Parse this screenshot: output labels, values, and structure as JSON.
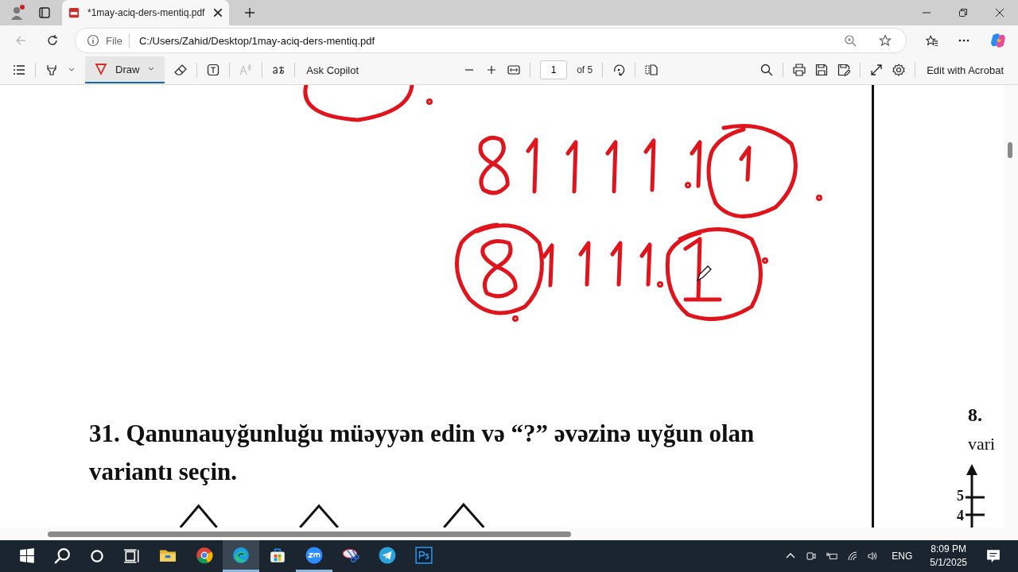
{
  "browser": {
    "tabs": [
      {
        "title": "*1may-aciq-ders-mentiq.pdf",
        "selected": true
      }
    ],
    "address": {
      "scheme_label": "File",
      "url": "C:/Users/Zahid/Desktop/1may-aciq-ders-mentiq.pdf"
    }
  },
  "pdf_toolbar": {
    "draw_label": "Draw",
    "draw_selected": true,
    "ask_label": "Ask Copilot",
    "page": "1",
    "page_count": "of 5",
    "acrobat_label": "Edit with Acrobat"
  },
  "document": {
    "question": {
      "number": "31.",
      "text": "Qanunauyğunluğu müəyyən edin və “?” əvəzinə uyğun olan variantı seçin."
    },
    "next_page": {
      "number_text": "8.",
      "line_2": "vari",
      "axis_ticks": [
        "5",
        "4"
      ]
    }
  },
  "taskbar": {
    "apps": [
      {
        "kind": "explorer",
        "active": false,
        "running": false
      },
      {
        "kind": "chrome",
        "active": false,
        "running": false
      },
      {
        "kind": "edge",
        "active": true,
        "running": true
      },
      {
        "kind": "store",
        "active": false,
        "running": false
      },
      {
        "kind": "zoom",
        "active": false,
        "running": true
      },
      {
        "kind": "snip",
        "active": false,
        "running": false
      },
      {
        "kind": "telegram",
        "active": false,
        "running": false
      },
      {
        "kind": "photoshop",
        "active": false,
        "running": false
      }
    ],
    "language": "ENG",
    "time": "8:09 PM",
    "date": "5/1/2025"
  }
}
